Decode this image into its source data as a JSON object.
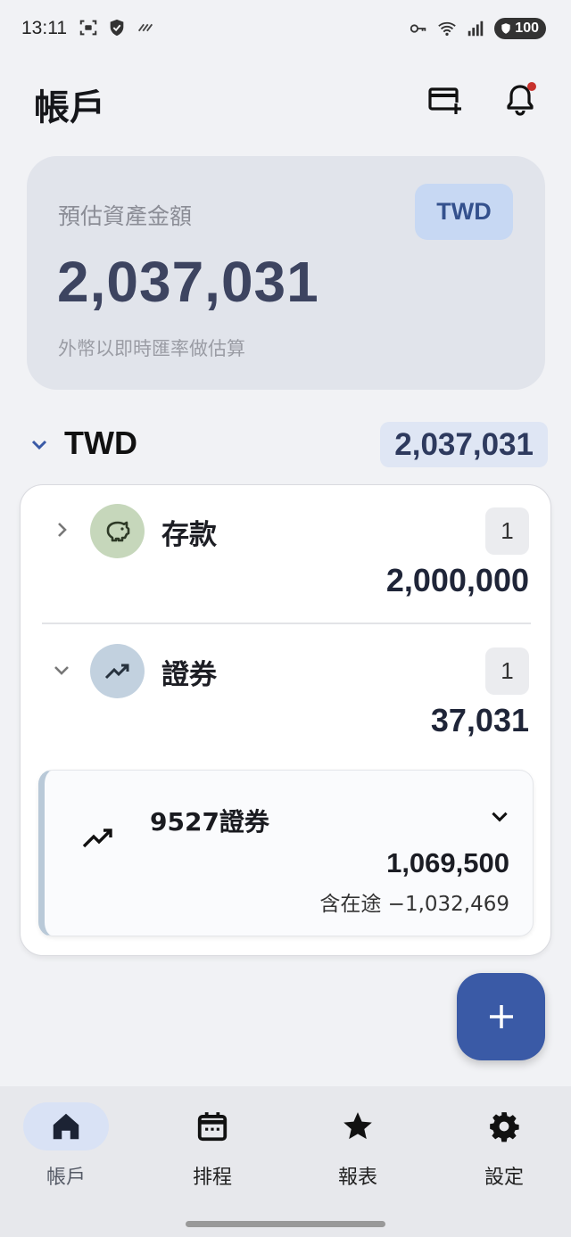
{
  "status_bar": {
    "time": "13:11",
    "battery": "100",
    "icons_left": [
      "screenshot-icon",
      "shield-icon",
      "signal-stripes-icon"
    ],
    "icons_right": [
      "key-icon",
      "wifi-icon",
      "cellular-icon",
      "battery-icon"
    ]
  },
  "header": {
    "title": "帳戶",
    "actions": [
      "add-card-icon",
      "bell-icon"
    ]
  },
  "summary": {
    "label": "預估資產金額",
    "currency": "TWD",
    "amount": "2,037,031",
    "note": "外幣以即時匯率做估算"
  },
  "currency_section": {
    "currency": "TWD",
    "total": "2,037,031",
    "categories": [
      {
        "label": "存款",
        "count": "1",
        "amount": "2,000,000",
        "icon": "piggy-bank-icon",
        "expanded": false
      },
      {
        "label": "證券",
        "count": "1",
        "amount": "37,031",
        "icon": "trending-up-icon",
        "expanded": true
      }
    ],
    "sub_account": {
      "name": "9527證券",
      "amount": "1,069,500",
      "note": "含在途 −1,032,469",
      "icon": "trending-up-icon"
    }
  },
  "fab": {
    "icon": "plus-icon"
  },
  "bottom_nav": {
    "items": [
      {
        "label": "帳戶",
        "icon": "home-icon",
        "active": true
      },
      {
        "label": "排程",
        "icon": "calendar-icon",
        "active": false
      },
      {
        "label": "報表",
        "icon": "star-icon",
        "active": false
      },
      {
        "label": "設定",
        "icon": "gear-icon",
        "active": false
      }
    ]
  },
  "colors": {
    "accent": "#3a5aa6",
    "summary_bg": "#e1e4eb",
    "chip_bg": "#c7d8f3",
    "deposit_icon_bg": "#c6d7bb",
    "securities_icon_bg": "#c2d1df"
  }
}
